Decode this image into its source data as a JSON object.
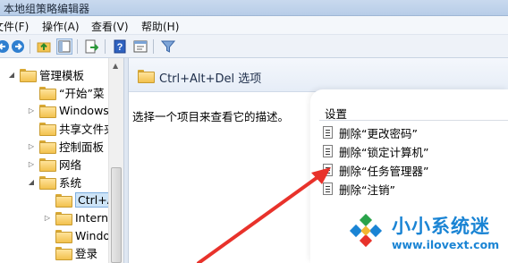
{
  "window": {
    "title": "本地组策略编辑器"
  },
  "menu": [
    "文件(F)",
    "操作(A)",
    "查看(V)",
    "帮助(H)"
  ],
  "toolbar": [
    "back-icon",
    "forward-icon",
    "up-folder-icon",
    "show-hide-tree-icon",
    "export-list-icon",
    "help-icon",
    "properties-icon",
    "filter-icon"
  ],
  "tree": {
    "items": [
      {
        "label": "管理模板",
        "expander": "◢"
      },
      {
        "label": "“开始”菜",
        "expander": ""
      },
      {
        "label": "Windows",
        "expander": "▷"
      },
      {
        "label": "共享文件夹",
        "expander": ""
      },
      {
        "label": "控制面板",
        "expander": "▷"
      },
      {
        "label": "网络",
        "expander": "▷"
      },
      {
        "label": "系统",
        "expander": "◢"
      },
      {
        "label": "Ctrl+Al",
        "expander": ""
      },
      {
        "label": "Intern",
        "expander": "▷"
      },
      {
        "label": "Windo",
        "expander": ""
      },
      {
        "label": "登录",
        "expander": ""
      }
    ]
  },
  "right": {
    "title": "Ctrl+Alt+Del 选项",
    "description": "选择一个项目来查看它的描述。",
    "column_header": "设置",
    "settings": [
      "删除“更改密码”",
      "删除“锁定计算机”",
      "删除“任务管理器”",
      "删除“注销”"
    ]
  },
  "watermark": {
    "name": "小小系统迷",
    "url": "www.ilovext.com"
  },
  "colors": {
    "accent": "#1a84d4",
    "annotation_arrow": "#e8322b"
  }
}
